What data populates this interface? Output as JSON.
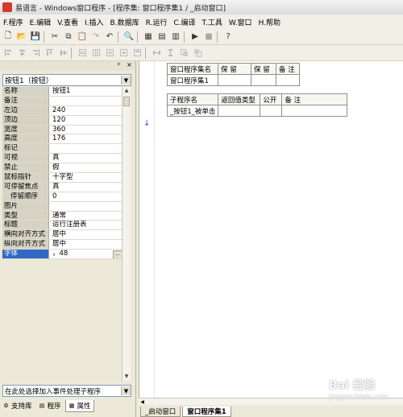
{
  "window": {
    "title": "易语言 - Windows窗口程序 - [程序集: 窗口程序集1 / _启动窗口]"
  },
  "menu": [
    "F.程序",
    "E.编辑",
    "V.查看",
    "I.插入",
    "B.数据库",
    "R.运行",
    "C.编译",
    "T.工具",
    "W.窗口",
    "H.帮助"
  ],
  "toolbar1": {
    "icons": [
      "new-file-icon",
      "open-folder-icon",
      "save-icon",
      "cut-icon",
      "copy-icon",
      "paste-icon",
      "redo-icon",
      "undo-icon",
      "find-icon",
      "layout-a-icon",
      "layout-b-icon",
      "layout-c-icon",
      "run-icon",
      "stop-icon",
      "help-icon"
    ],
    "glyphs": [
      "🗋",
      "📂",
      "💾",
      "✂",
      "⧉",
      "📋",
      "↷",
      "↶",
      "🔍",
      "▦",
      "▤",
      "▥",
      "▶",
      "■",
      "?"
    ]
  },
  "panel": {
    "pin": "ᵖ",
    "close": "×"
  },
  "object_selector": {
    "value": "按钮1（按钮）",
    "arrow": "▼"
  },
  "properties": [
    {
      "name": "名称",
      "value": "按钮1"
    },
    {
      "name": "备注",
      "value": ""
    },
    {
      "name": "左边",
      "value": "240"
    },
    {
      "name": "顶边",
      "value": "120"
    },
    {
      "name": "宽度",
      "value": "360"
    },
    {
      "name": "高度",
      "value": "176"
    },
    {
      "name": "标记",
      "value": ""
    },
    {
      "name": "可视",
      "value": "真"
    },
    {
      "name": "禁止",
      "value": "假"
    },
    {
      "name": "鼠标指针",
      "value": "十字型"
    },
    {
      "name": "可停留焦点",
      "value": "真"
    },
    {
      "name": "停留顺序",
      "value": "0"
    },
    {
      "name": "图片",
      "value": ""
    },
    {
      "name": "类型",
      "value": "通常"
    },
    {
      "name": "标题",
      "value": "运行注册表"
    },
    {
      "name": "横向对齐方式",
      "value": "居中"
    },
    {
      "name": "纵向对齐方式",
      "value": "居中"
    },
    {
      "name": "字体",
      "value": "，48"
    }
  ],
  "property_dots": "...",
  "event_selector": {
    "value": "在此处选择加入事件处理子程序",
    "arrow": "▼"
  },
  "left_tabs": [
    "支持库",
    "程序",
    "属性"
  ],
  "assembly_table": {
    "headers": [
      "窗口程序集名",
      "保 留",
      "保 留",
      "备 注"
    ],
    "rows": [
      [
        "窗口程序集1",
        "",
        "",
        ""
      ]
    ]
  },
  "sub_table": {
    "headers": [
      "子程序名",
      "返回值类型",
      "公开",
      "备 注"
    ],
    "rows": [
      [
        "_按钮1_被单击",
        "",
        "",
        ""
      ]
    ]
  },
  "gutter_marker": "↓",
  "editor_tabs": [
    "_启动窗口",
    "窗口程序集1"
  ],
  "watermark": {
    "main": "Bai 经验",
    "sub": "jingyan.baidu.com"
  }
}
